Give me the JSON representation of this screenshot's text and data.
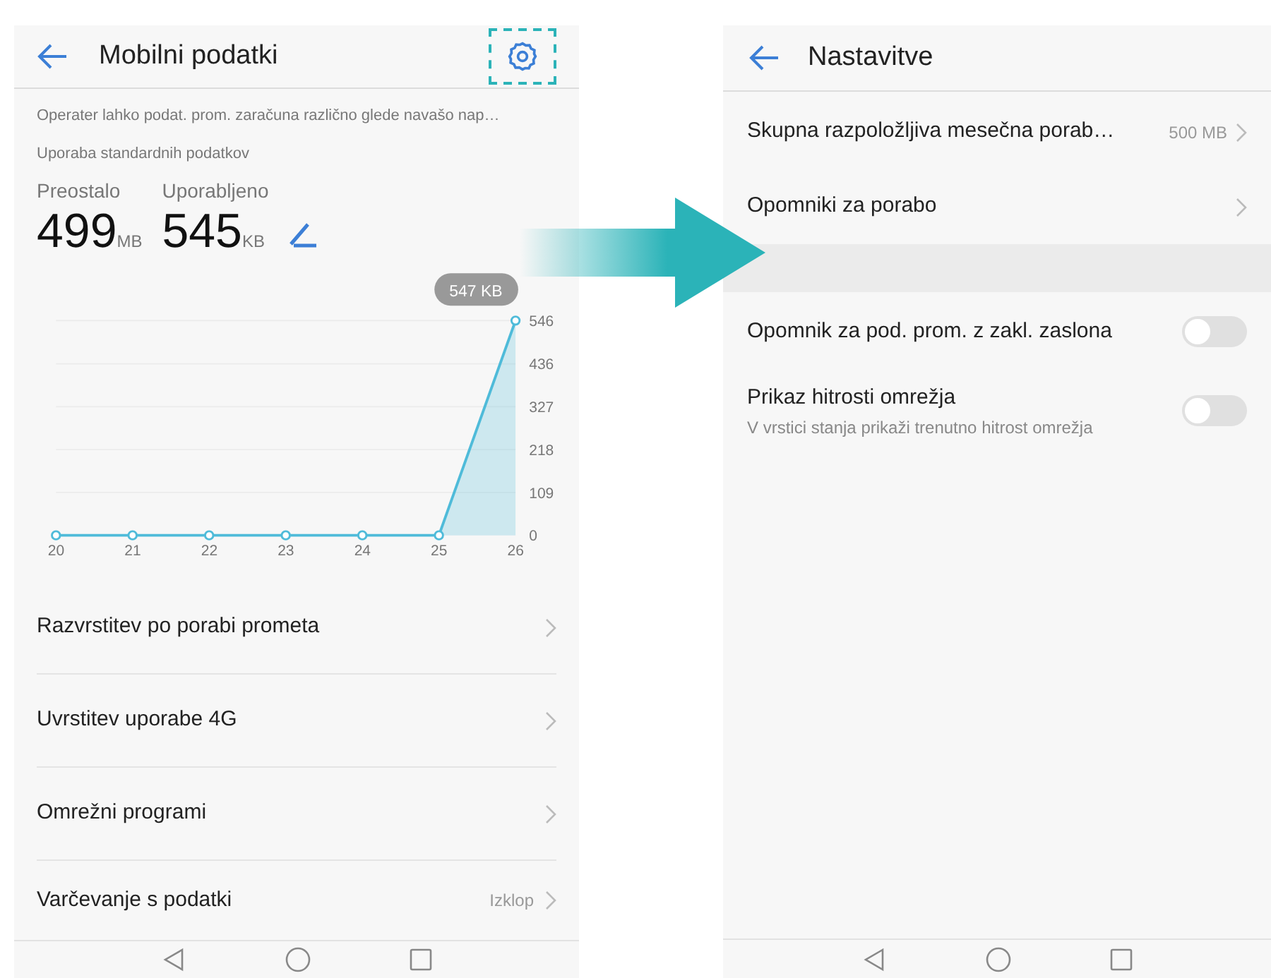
{
  "left_screen": {
    "title": "Mobilni podatki",
    "notice": "Operater lahko podat. prom. zaračuna različno glede navašo nap…",
    "section_label": "Uporaba standardnih podatkov",
    "stats": [
      {
        "label": "Preostalo",
        "value": "499",
        "unit": "MB"
      },
      {
        "label": "Uporabljeno",
        "value": "545",
        "unit": "KB"
      }
    ],
    "tooltip": "547 KB",
    "chart_data": {
      "type": "area",
      "x": [
        "20",
        "21",
        "22",
        "23",
        "24",
        "25",
        "26"
      ],
      "series": [
        {
          "color": "#4fbbd9",
          "values": [
            0,
            0,
            0,
            0,
            0,
            0,
            546
          ]
        }
      ],
      "grid": true,
      "ylim": [
        0,
        546
      ],
      "yticks": [
        0,
        109,
        218,
        327,
        436,
        546
      ]
    },
    "items": [
      {
        "label": "Razvrstitev po porabi prometa"
      },
      {
        "label": "Uvrstitev uporabe 4G"
      },
      {
        "label": "Omrežni programi"
      },
      {
        "label": "Varčevanje s podatki",
        "value": "Izklop"
      }
    ]
  },
  "right_screen": {
    "title": "Nastavitve",
    "items": [
      {
        "kind": "link",
        "label": "Skupna razpoložljiva mesečna porab…",
        "value": "500 MB"
      },
      {
        "kind": "link",
        "label": "Opomniki za porabo"
      },
      {
        "kind": "spacer"
      },
      {
        "kind": "toggle",
        "label": "Opomnik za pod. prom. z zakl. zaslona",
        "on": false
      },
      {
        "kind": "toggle",
        "label": "Prikaz hitrosti omrežja",
        "sublabel": "V vrstici stanja prikaži trenutno hitrost omrežja",
        "on": false
      }
    ]
  }
}
